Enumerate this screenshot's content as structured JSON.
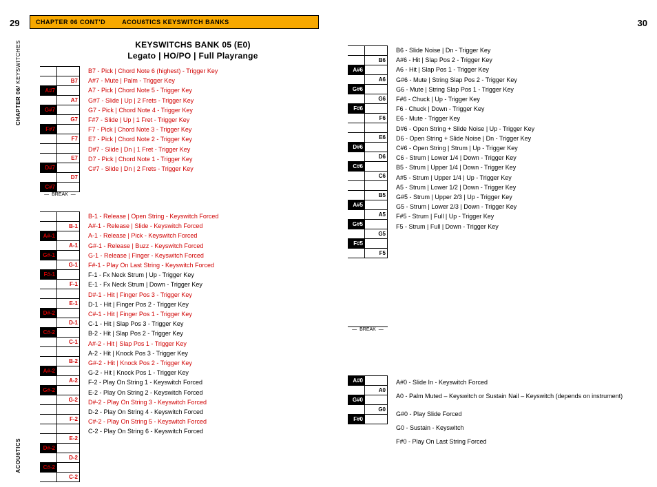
{
  "pageLeft": "29",
  "pageRight": "30",
  "headerA": "CHAPTER 06 CONT'D",
  "headerB": "ACOU6TICS KEYSWITCH BANKS",
  "sideTopBold": "CHAPTER 06/",
  "sideTopThin": " KEYSWITCHES",
  "sideBottom": "ACOU6TICS",
  "titleLine1": "KEYSWITCHS BANK 05 (E0)",
  "titleLine2": "Legato | HO/PO | Full Playrange",
  "breakLabel": "BREAK",
  "leftA": {
    "keys": [
      {
        "bk": "",
        "wk": "B7"
      },
      {
        "bk": "A#7",
        "wk": "A7"
      },
      {
        "bk": "G#7",
        "wk": "G7"
      },
      {
        "bk": "F#7",
        "wk": "F7"
      },
      {
        "bk": "",
        "wk": "E7"
      },
      {
        "bk": "D#7",
        "wk": "D7"
      },
      {
        "bk": "C#7",
        "wk": ""
      }
    ],
    "desc": [
      {
        "t": "B7 - Pick | Chord Note 6 (highest) - Trigger Key",
        "r": 1
      },
      {
        "t": "A#7 - Mute | Palm - Trigger Key",
        "r": 1
      },
      {
        "t": "A7 - Pick | Chord Note 5 - Trigger Key",
        "r": 1
      },
      {
        "t": "G#7 - Slide | Up | 2 Frets - Trigger Key",
        "r": 1
      },
      {
        "t": "G7 - Pick | Chord Note 4 - Trigger Key",
        "r": 1
      },
      {
        "t": "F#7 - Slide | Up | 1 Fret - Trigger Key",
        "r": 1
      },
      {
        "t": "F7 - Pick | Chord Note 3 - Trigger Key",
        "r": 1
      },
      {
        "t": "E7 - Pick | Chord Note 2 - Trigger Key",
        "r": 1
      },
      {
        "t": "D#7 - Slide | Dn | 1 Fret - Trigger Key",
        "r": 1
      },
      {
        "t": "D7 - Pick | Chord Note 1 - Trigger Key",
        "r": 1
      },
      {
        "t": "C#7 - Slide | Dn | 2 Frets - Trigger Key",
        "r": 1
      }
    ]
  },
  "leftB": {
    "keys": [
      {
        "bk": "",
        "wk": "B-1"
      },
      {
        "bk": "A#-1",
        "wk": "A-1"
      },
      {
        "bk": "G#-1",
        "wk": "G-1"
      },
      {
        "bk": "F#-1",
        "wk": "F-1"
      },
      {
        "bk": "",
        "wk": "E-1"
      },
      {
        "bk": "D#-2",
        "wk": "D-1"
      },
      {
        "bk": "C#-2",
        "wk": "C-1"
      },
      {
        "bk": "",
        "wk": "B-2"
      },
      {
        "bk": "A#-2",
        "wk": "A-2"
      },
      {
        "bk": "G#-2",
        "wk": "G-2"
      },
      {
        "bk": "",
        "wk": "F-2"
      },
      {
        "bk": "",
        "wk": "E-2"
      },
      {
        "bk": "D#-2",
        "wk": "D-2"
      },
      {
        "bk": "C#-2",
        "wk": "C-2"
      }
    ],
    "desc": [
      {
        "t": "B-1 - Release | Open String - Keyswitch Forced",
        "r": 1
      },
      {
        "t": "A#-1 - Release | Slide - Keyswitch Forced",
        "r": 1
      },
      {
        "t": "A-1 - Release | Pick - Keyswitch Forced",
        "r": 1
      },
      {
        "t": "G#-1 - Release | Buzz - Keyswitch Forced",
        "r": 1
      },
      {
        "t": "G-1 - Release | Finger - Keyswitch Forced",
        "r": 1
      },
      {
        "t": "F#-1 - Play On Last String - Keyswitch Forced",
        "r": 1
      },
      {
        "t": "F-1 - Fx Neck Strum | Up - Trigger Key",
        "r": 0
      },
      {
        "t": "E-1 - Fx Neck Strum | Down - Trigger Key",
        "r": 0
      },
      {
        "t": "D#-1 - Hit | Finger Pos 3 - Trigger Key",
        "r": 1
      },
      {
        "t": "D-1 - Hit | Finger Pos 2 - Trigger Key",
        "r": 0
      },
      {
        "t": "C#-1 - Hit | Finger Pos 1 - Trigger Key",
        "r": 1
      },
      {
        "t": "C-1 - Hit | Slap Pos 3 - Trigger Key",
        "r": 0
      },
      {
        "t": "B-2 - Hit | Slap Pos 2 - Trigger Key",
        "r": 0
      },
      {
        "t": "A#-2 - Hit | Slap Pos 1 - Trigger Key",
        "r": 1
      },
      {
        "t": "A-2 - Hit | Knock Pos 3 - Trigger Key",
        "r": 0
      },
      {
        "t": "G#-2 - Hit | Knock Pos 2 - Trigger Key",
        "r": 1
      },
      {
        "t": "G-2 - Hit | Knock Pos 1 - Trigger Key",
        "r": 0
      },
      {
        "t": "",
        "r": 0
      },
      {
        "t": "F-2 - Play On String 1 - Keyswitch Forced",
        "r": 0
      },
      {
        "t": "E-2 - Play On String 2 - Keyswitch Forced",
        "r": 0
      },
      {
        "t": "D#-2 - Play On String 3 - Keyswitch Forced",
        "r": 1
      },
      {
        "t": "D-2 - Play On String 4 - Keyswitch Forced",
        "r": 0
      },
      {
        "t": "C#-2 - Play On String 5 - Keyswitch Forced",
        "r": 1
      },
      {
        "t": "C-2 - Play On String 6 - Keyswitch Forced",
        "r": 0
      }
    ]
  },
  "rightA": {
    "keys": [
      {
        "bk": "",
        "wk": "B6"
      },
      {
        "bk": "A#6",
        "wk": "A6"
      },
      {
        "bk": "G#6",
        "wk": "G6"
      },
      {
        "bk": "F#6",
        "wk": "F6"
      },
      {
        "bk": "",
        "wk": "E6"
      },
      {
        "bk": "D#6",
        "wk": "D6"
      },
      {
        "bk": "C#6",
        "wk": "C6"
      },
      {
        "bk": "",
        "wk": "B5"
      },
      {
        "bk": "A#5",
        "wk": "A5"
      },
      {
        "bk": "G#5",
        "wk": "G5"
      },
      {
        "bk": "F#5",
        "wk": "F5"
      }
    ],
    "desc": [
      {
        "t": "B6 - Slide Noise | Dn - Trigger Key",
        "r": 0
      },
      {
        "t": "A#6 - Hit | Slap Pos 2 - Trigger Key",
        "r": 0
      },
      {
        "t": "A6 - Hit | Slap Pos 1 - Trigger Key",
        "r": 0
      },
      {
        "t": "G#6 - Mute | String Slap Pos 2 - Trigger Key",
        "r": 0
      },
      {
        "t": "G6 - Mute | String Slap Pos 1 - Trigger Key",
        "r": 0
      },
      {
        "t": "F#6 - Chuck | Up - Trigger Key",
        "r": 0
      },
      {
        "t": "F6 - Chuck | Down - Trigger Key",
        "r": 0
      },
      {
        "t": "E6 - Mute - Trigger Key",
        "r": 0
      },
      {
        "t": "D#6 - Open String + Slide Noise | Up - Trigger Key",
        "r": 0
      },
      {
        "t": "D6 - Open String + Slide Noise | Dn - Trigger Key",
        "r": 0
      },
      {
        "t": "C#6 - Open String | Strum | Up - Trigger Key",
        "r": 0
      },
      {
        "t": "C6 - Strum | Lower 1/4 | Down - Trigger Key",
        "r": 0
      },
      {
        "t": "B5 - Strum | Upper 1/4 | Down - Trigger Key",
        "r": 0
      },
      {
        "t": "A#5 - Strum | Upper 1/4 | Up - Trigger Key",
        "r": 0
      },
      {
        "t": "A5 - Strum | Lower 1/2 | Down - Trigger Key",
        "r": 0
      },
      {
        "t": "G#5 - Strum | Upper 2/3 | Up - Trigger Key",
        "r": 0
      },
      {
        "t": "G5 - Strum | Lower 2/3 | Down - Trigger Key",
        "r": 0
      },
      {
        "t": "F#5 - Strum | Full | Up - Trigger Key",
        "r": 0
      },
      {
        "t": "F5 - Strum | Full | Down - Trigger Key",
        "r": 0
      }
    ]
  },
  "rightB": {
    "keys": [
      {
        "bk": "A#0",
        "wk": "A0"
      },
      {
        "bk": "G#0",
        "wk": "G0"
      },
      {
        "bk": "F#0",
        "wk": ""
      }
    ],
    "desc": [
      {
        "t": "A#0 - Slide In - Keyswitch Forced",
        "r": 0
      },
      {
        "t": "A0 - Palm Muted – Keyswitch or Sustain Nail – Keyswitch (depends on instrument)",
        "r": 0,
        "wrap": 1
      },
      {
        "t": "G#0 - Play Slide Forced",
        "r": 0
      },
      {
        "t": "G0 - Sustain - Keyswitch",
        "r": 0
      },
      {
        "t": "F#0 - Play On Last String Forced",
        "r": 0
      }
    ]
  }
}
